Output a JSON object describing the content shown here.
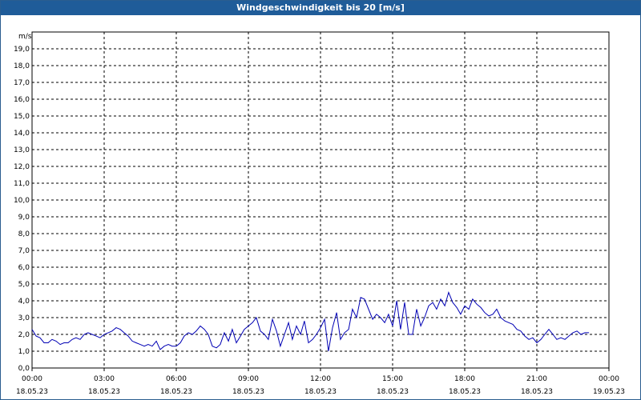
{
  "window": {
    "title": "Windgeschwindigkeit bis 20 [m/s]"
  },
  "colors": {
    "titlebar": "#1f5c99",
    "series": "#0000b4",
    "grid": "#000000"
  },
  "chart_data": {
    "type": "line",
    "title": "Windgeschwindigkeit bis 20 [m/s]",
    "ylabel": "m/s",
    "xlabel": "",
    "ylim": [
      0,
      20
    ],
    "xlim_hours": [
      0,
      24
    ],
    "grid": true,
    "legend": "none",
    "y_ticks": [
      "0,0",
      "1,0",
      "2,0",
      "3,0",
      "4,0",
      "5,0",
      "6,0",
      "7,0",
      "8,0",
      "9,0",
      "10,0",
      "11,0",
      "12,0",
      "13,0",
      "14,0",
      "15,0",
      "16,0",
      "17,0",
      "18,0",
      "19,0"
    ],
    "x_ticks": [
      {
        "time": "00:00",
        "date": "18.05.23"
      },
      {
        "time": "03:00",
        "date": "18.05.23"
      },
      {
        "time": "06:00",
        "date": "18.05.23"
      },
      {
        "time": "09:00",
        "date": "18.05.23"
      },
      {
        "time": "12:00",
        "date": "18.05.23"
      },
      {
        "time": "15:00",
        "date": "18.05.23"
      },
      {
        "time": "18:00",
        "date": "18.05.23"
      },
      {
        "time": "21:00",
        "date": "18.05.23"
      },
      {
        "time": "00:00",
        "date": "19.05.23"
      }
    ],
    "series": [
      {
        "color": "#0000b4",
        "x_hours": [
          0.0,
          0.17,
          0.33,
          0.5,
          0.67,
          0.83,
          1.0,
          1.17,
          1.33,
          1.5,
          1.67,
          1.83,
          2.0,
          2.17,
          2.33,
          2.5,
          2.67,
          2.83,
          3.0,
          3.17,
          3.33,
          3.5,
          3.67,
          3.83,
          4.0,
          4.17,
          4.33,
          4.5,
          4.67,
          4.83,
          5.0,
          5.17,
          5.33,
          5.5,
          5.67,
          5.83,
          6.0,
          6.17,
          6.33,
          6.5,
          6.67,
          6.83,
          7.0,
          7.17,
          7.33,
          7.5,
          7.67,
          7.83,
          8.0,
          8.17,
          8.33,
          8.5,
          8.67,
          8.83,
          9.0,
          9.17,
          9.33,
          9.5,
          9.67,
          9.83,
          10.0,
          10.17,
          10.33,
          10.5,
          10.67,
          10.83,
          11.0,
          11.17,
          11.33,
          11.5,
          11.67,
          11.83,
          12.0,
          12.17,
          12.33,
          12.5,
          12.67,
          12.83,
          13.0,
          13.17,
          13.33,
          13.5,
          13.67,
          13.83,
          14.0,
          14.17,
          14.33,
          14.5,
          14.67,
          14.83,
          15.0,
          15.17,
          15.33,
          15.5,
          15.67,
          15.83,
          16.0,
          16.17,
          16.33,
          16.5,
          16.67,
          16.83,
          17.0,
          17.17,
          17.33,
          17.5,
          17.67,
          17.83,
          18.0,
          18.17,
          18.33,
          18.5,
          18.67,
          18.83,
          19.0,
          19.17,
          19.33,
          19.5,
          19.67,
          19.83,
          20.0,
          20.17,
          20.33,
          20.5,
          20.67,
          20.83,
          21.0,
          21.17,
          21.33,
          21.5,
          21.67,
          21.83,
          22.0,
          22.17,
          22.33,
          22.5,
          22.67,
          22.83,
          23.0,
          23.17,
          23.33,
          23.5,
          23.67,
          23.83
        ],
        "values": [
          2.3,
          1.9,
          1.8,
          1.5,
          1.5,
          1.7,
          1.6,
          1.4,
          1.5,
          1.5,
          1.7,
          1.8,
          1.7,
          2.0,
          2.1,
          2.0,
          1.9,
          1.8,
          2.0,
          2.1,
          2.2,
          2.4,
          2.3,
          2.1,
          1.9,
          1.6,
          1.5,
          1.4,
          1.3,
          1.4,
          1.3,
          1.6,
          1.1,
          1.3,
          1.4,
          1.3,
          1.3,
          1.5,
          1.9,
          2.1,
          2.0,
          2.2,
          2.5,
          2.3,
          2.0,
          1.3,
          1.2,
          1.4,
          2.1,
          1.6,
          2.3,
          1.5,
          1.9,
          2.3,
          2.5,
          2.7,
          3.0,
          2.2,
          2.0,
          1.7,
          2.9,
          2.2,
          1.3,
          2.0,
          2.7,
          1.7,
          2.5,
          2.0,
          2.8,
          1.5,
          1.7,
          2.0,
          2.4,
          2.9,
          1.0,
          2.4,
          3.3,
          1.7,
          2.1,
          2.3,
          3.5,
          3.0,
          4.2,
          4.1,
          3.5,
          2.9,
          3.2,
          3.0,
          2.7,
          3.2,
          2.5,
          4.0,
          2.3,
          3.9,
          2.0,
          2.0,
          3.5,
          2.5,
          3.0,
          3.7,
          3.9,
          3.5,
          4.1,
          3.7,
          4.5,
          3.9,
          3.6,
          3.2,
          3.7,
          3.5,
          4.1,
          3.8,
          3.6,
          3.3,
          3.1,
          3.2,
          3.5,
          3.0,
          2.8,
          2.7,
          2.6,
          2.3,
          2.2,
          1.9,
          1.7,
          1.8,
          1.5,
          1.7,
          2.0,
          2.3,
          2.0,
          1.7,
          1.8,
          1.7,
          1.9,
          2.1,
          2.2,
          2.0,
          2.1,
          2.1
        ]
      }
    ]
  }
}
